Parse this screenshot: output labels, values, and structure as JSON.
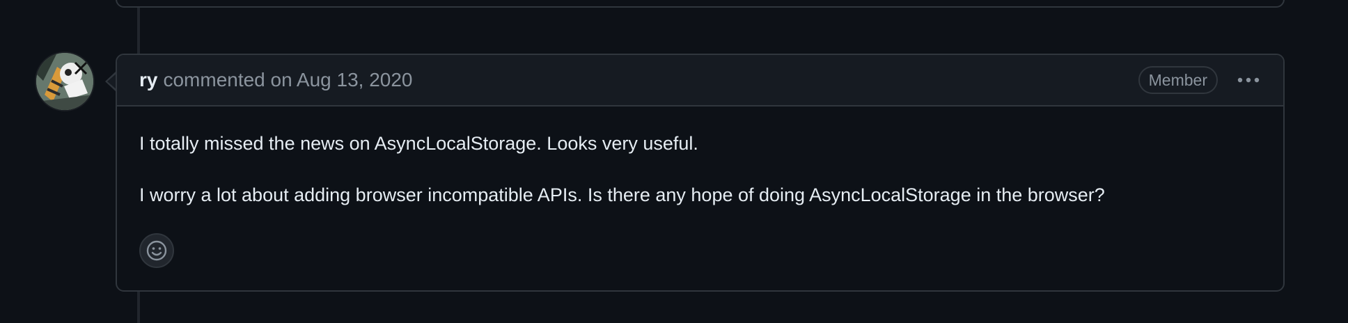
{
  "comment": {
    "author": "ry",
    "meta": "commented on Aug 13, 2020",
    "badge": "Member",
    "menu_icon": "kebab-horizontal-icon",
    "avatar_icon": "user-avatar",
    "reaction_icon": "smiley-icon",
    "paragraphs": [
      "I totally missed the news on AsyncLocalStorage. Looks very useful.",
      "I worry a lot about adding browser incompatible APIs. Is there any hope of doing AsyncLocalStorage in the browser?"
    ]
  },
  "colors": {
    "background": "#0d1117",
    "header_background": "#161b22",
    "border": "#30363d",
    "text_primary": "#e6edf3",
    "text_muted": "#8b949e"
  }
}
